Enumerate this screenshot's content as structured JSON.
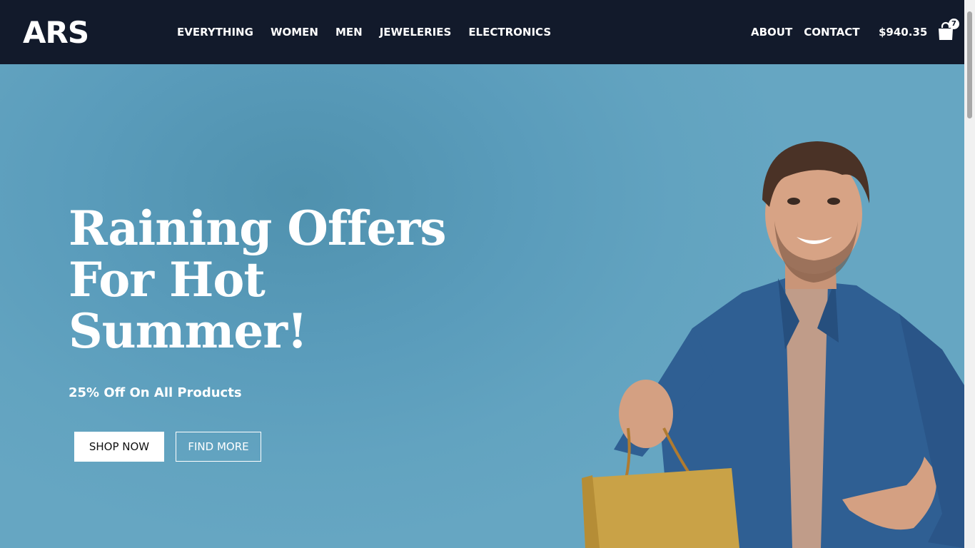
{
  "header": {
    "logo": "ARS",
    "nav_left": [
      "EVERYTHING",
      "WOMEN",
      "MEN",
      "JEWELERIES",
      "ELECTRONICS"
    ],
    "nav_right": [
      "ABOUT",
      "CONTACT"
    ],
    "cart_total": "$940.35",
    "cart_count": "7",
    "cart_icon": "shopping-bag-icon"
  },
  "hero": {
    "title_lines": [
      "Raining Offers",
      "For Hot",
      "Summer!"
    ],
    "subtitle": "25% Off On All Products",
    "primary_button": "SHOP NOW",
    "secondary_button": "FIND MORE"
  },
  "colors": {
    "header_bg": "#121a2b",
    "hero_bg": "#5d9fbd",
    "text": "#ffffff"
  }
}
